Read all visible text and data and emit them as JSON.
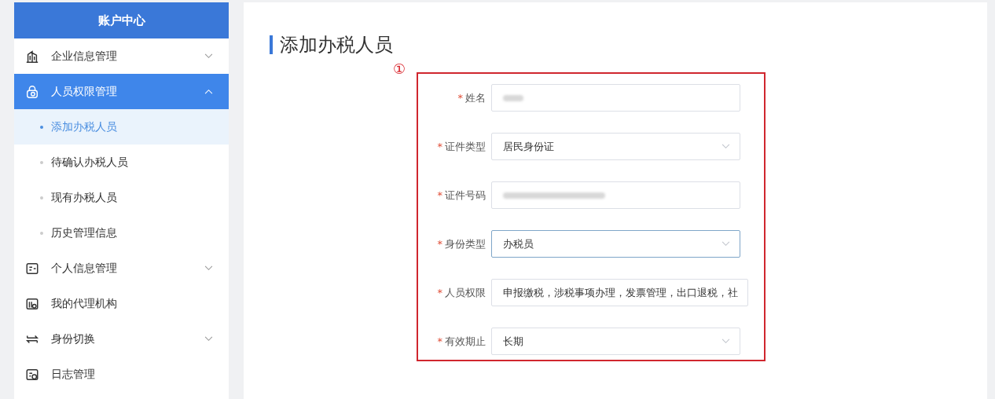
{
  "sidebar": {
    "title": "账户中心",
    "items": [
      {
        "label": "企业信息管理",
        "expanded": false,
        "selected": false
      },
      {
        "label": "人员权限管理",
        "expanded": true,
        "selected": true,
        "children": [
          {
            "label": "添加办税人员",
            "selected": true
          },
          {
            "label": "待确认办税人员",
            "selected": false
          },
          {
            "label": "现有办税人员",
            "selected": false
          },
          {
            "label": "历史管理信息",
            "selected": false
          }
        ]
      },
      {
        "label": "个人信息管理",
        "expanded": false,
        "selected": false
      },
      {
        "label": "我的代理机构",
        "selected": false
      },
      {
        "label": "身份切换",
        "expanded": false,
        "selected": false
      },
      {
        "label": "日志管理",
        "selected": false
      }
    ]
  },
  "page": {
    "title": "添加办税人员",
    "annotation": "①",
    "fields": [
      {
        "label": "姓名",
        "required_mark": "*",
        "kind": "text",
        "redacted": true,
        "focused": false
      },
      {
        "label": "证件类型",
        "required_mark": "*",
        "kind": "select",
        "value": "居民身份证",
        "focused": false
      },
      {
        "label": "证件号码",
        "required_mark": "*",
        "kind": "text",
        "redacted": true,
        "focused": false
      },
      {
        "label": "身份类型",
        "required_mark": "*",
        "kind": "select",
        "value": "办税员",
        "focused": true
      },
      {
        "label": "人员权限",
        "required_mark": "*",
        "kind": "text",
        "value": "申报缴税，涉税事项办理，发票管理，出口退税，社",
        "focused": false
      },
      {
        "label": "有效期止",
        "required_mark": "*",
        "kind": "select",
        "value": "长期",
        "focused": false
      }
    ]
  }
}
